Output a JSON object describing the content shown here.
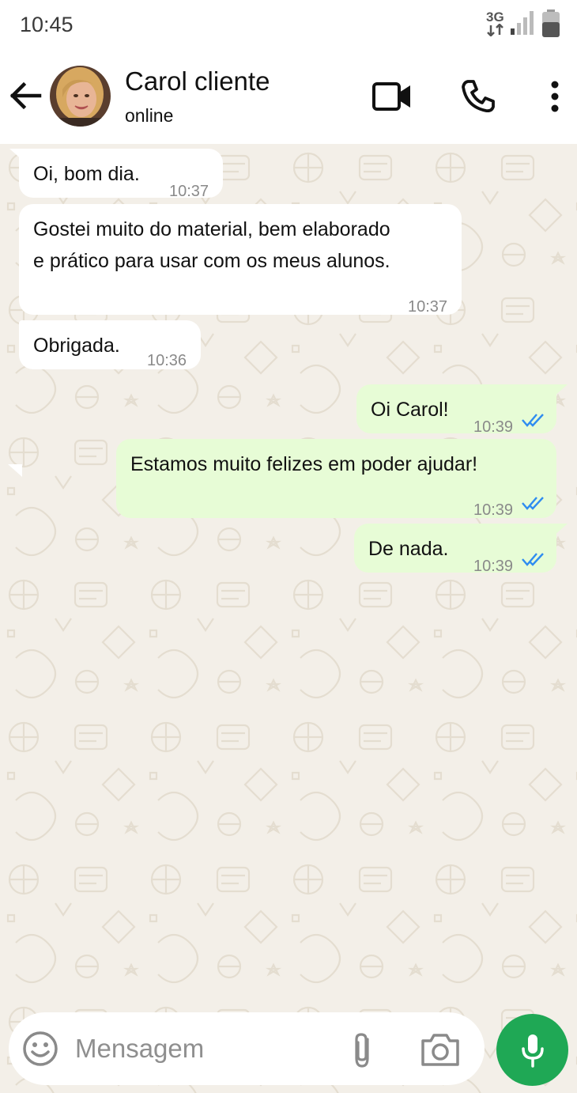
{
  "status_bar": {
    "time": "10:45",
    "network": "3G"
  },
  "header": {
    "contact_name": "Carol cliente",
    "contact_status": "online",
    "icons": [
      "back-arrow-icon",
      "video-call-icon",
      "phone-icon",
      "more-options-icon"
    ]
  },
  "messages": [
    {
      "direction": "incoming",
      "lines": [
        "Oi, bom dia."
      ],
      "time": "10:37"
    },
    {
      "direction": "incoming",
      "lines": [
        "Gostei muito do material, bem elaborado",
        "e prático para usar com os meus alunos."
      ],
      "time": "10:37"
    },
    {
      "direction": "incoming",
      "lines": [
        "Obrigada."
      ],
      "time": "10:36"
    },
    {
      "direction": "outgoing",
      "lines": [
        "Oi Carol!"
      ],
      "time": "10:39",
      "status": "read"
    },
    {
      "direction": "outgoing",
      "lines": [
        "Estamos muito felizes em poder ajudar!"
      ],
      "time": "10:39",
      "status": "read"
    },
    {
      "direction": "outgoing",
      "lines": [
        "De nada."
      ],
      "time": "10:39",
      "status": "read"
    }
  ],
  "composer": {
    "placeholder": "Mensagem",
    "icons": [
      "emoji-icon",
      "attach-icon",
      "camera-icon",
      "mic-icon"
    ]
  },
  "colors": {
    "chat_background": "#f3efe8",
    "incoming_bubble": "#ffffff",
    "outgoing_bubble": "#e7fcd6",
    "read_ticks": "#2f8cf0",
    "mic_button": "#1fa855"
  }
}
